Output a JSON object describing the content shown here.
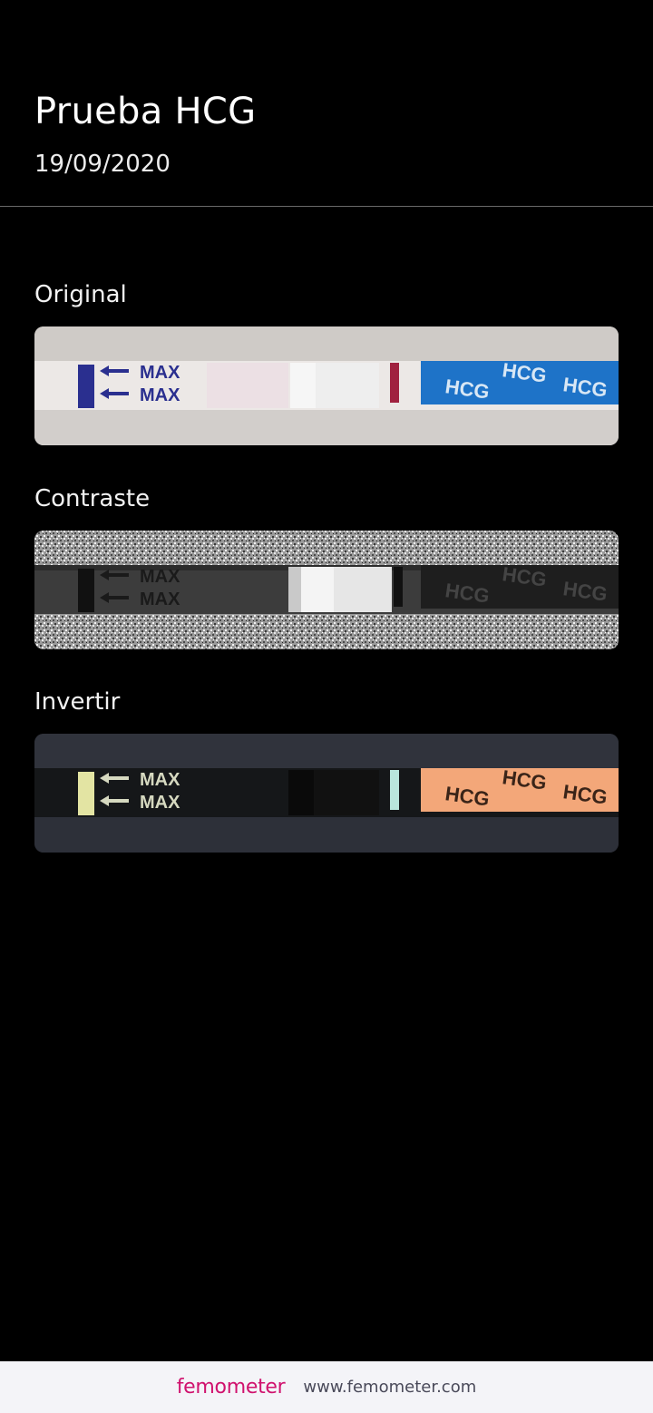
{
  "header": {
    "title": "Prueba HCG",
    "date": "19/09/2020"
  },
  "sections": [
    {
      "label": "Original"
    },
    {
      "label": "Contraste"
    },
    {
      "label": "Invertir"
    }
  ],
  "strip": {
    "max_text": "MAX",
    "hcg_text": "HCG"
  },
  "footer": {
    "brand": "femometer",
    "website": "www.femometer.com"
  },
  "colors": {
    "brand": "#d0126e",
    "max_blue": "#2a2f8f",
    "test_line": "#a0213f",
    "hcg_blue": "#1e73c8",
    "hcg_orange": "#f3a779"
  }
}
